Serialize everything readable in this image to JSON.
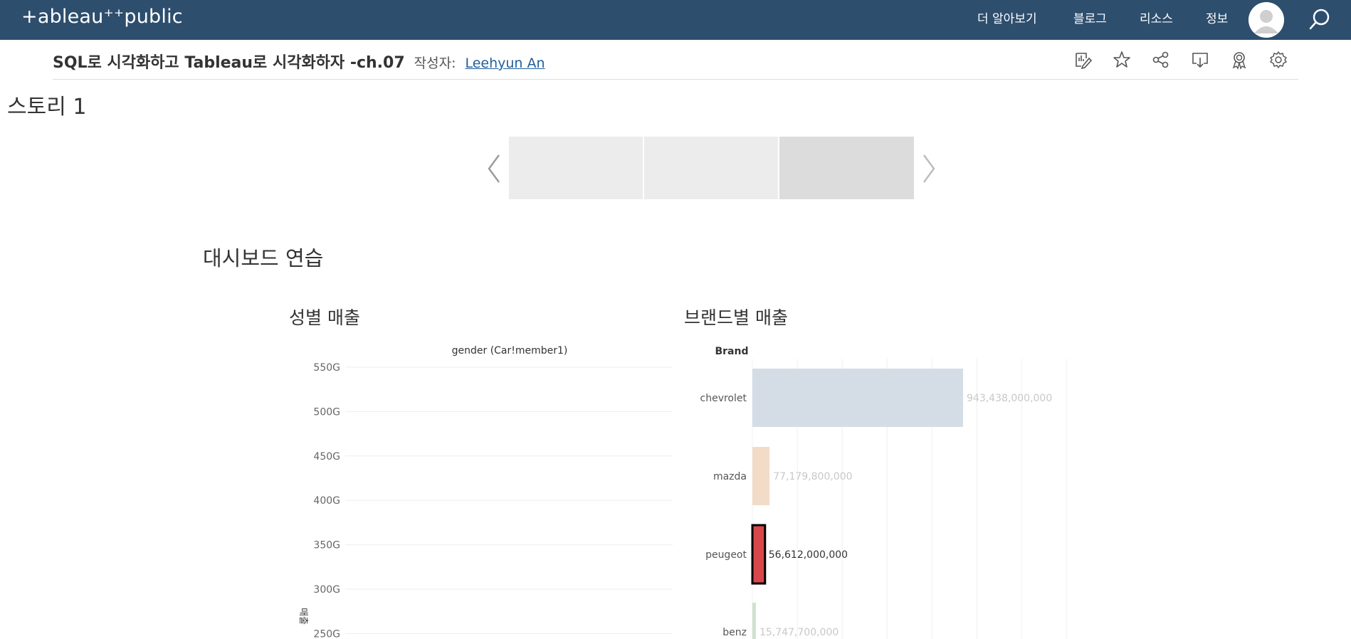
{
  "header": {
    "logo": "+ableau⁺⁺public",
    "nav": [
      "더 알아보기",
      "블로그",
      "리소스",
      "정보"
    ]
  },
  "viz": {
    "title": "SQL로 시각화하고 Tableau로 시각화하자 -ch.07",
    "by_label": "작성자:",
    "author": "Leehyun An"
  },
  "story": {
    "title": "스토리 1",
    "points": 3,
    "active_point": 3
  },
  "dashboard": {
    "title": "대시보드 연습"
  },
  "colors": {
    "topbar": "#2d4e6d",
    "panel": "#ececec",
    "panel_active": "#dcdcdc",
    "chevrolet": "#d4dde5",
    "mazda": "#f2dcc8",
    "peugeot": "#d9474b",
    "benz": "#cfe3cf"
  },
  "chart_data": [
    {
      "type": "bar",
      "title": "성별 매출",
      "xlabel": "gender (Car!member1)",
      "ylabel": "매출",
      "ytick_labels": [
        "550G",
        "500G",
        "450G",
        "400G",
        "350G",
        "300G",
        "250G"
      ],
      "ylim": [
        250,
        550
      ],
      "categories": [],
      "values": []
    },
    {
      "type": "bar",
      "title": "브랜드별 매출",
      "axis_title": "Brand",
      "orientation": "horizontal",
      "categories": [
        "chevrolet",
        "mazda",
        "peugeot",
        "benz"
      ],
      "values": [
        943438000000,
        77179800000,
        56612000000,
        15747700000
      ],
      "data_labels": [
        "943,438,000,000",
        "77,179,800,000",
        "56,612,000,000",
        "15,747,700,000"
      ],
      "highlighted": "peugeot"
    }
  ]
}
